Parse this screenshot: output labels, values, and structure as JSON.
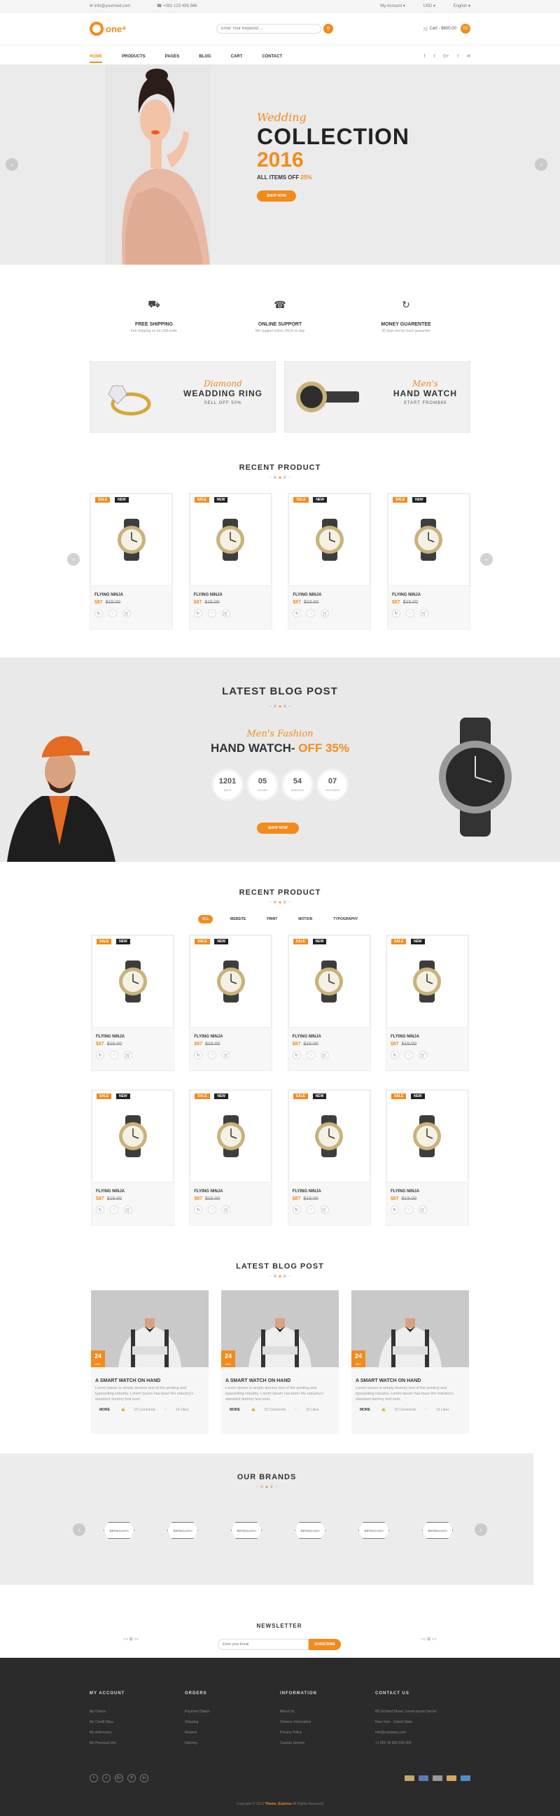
{
  "topbar": {
    "email": "info@yourmail.com",
    "phone": "+002 123 456 566",
    "account": "My Account",
    "currency": "USD",
    "language": "English"
  },
  "header": {
    "logo": "one",
    "logo_sup": "+",
    "search_placeholder": "Enter Your Keyword ...",
    "cart_label": "Cart - $600.00",
    "cart_count": "02"
  },
  "nav": {
    "items": [
      "HOME",
      "PRODUCTS",
      "PAGES",
      "BLOG",
      "CART",
      "CONTACT"
    ],
    "social": [
      "f",
      "t",
      "G+",
      "f",
      "✉"
    ]
  },
  "hero": {
    "script": "Wedding",
    "title": "COLLECTION",
    "year": "2016",
    "offer_prefix": "ALL ITEMS OFF ",
    "offer_value": "25%",
    "button": "SHOP NOW"
  },
  "features": [
    {
      "icon": "truck-icon",
      "glyph": "⛟",
      "title": "FREE SHIPPING",
      "sub": "free shipping on all USA order"
    },
    {
      "icon": "headset-icon",
      "glyph": "☎",
      "title": "ONLINE SUPPORT",
      "sub": "We support online 24/24 on day"
    },
    {
      "icon": "refresh-icon",
      "glyph": "↻",
      "title": "MONEY GUARENTEE",
      "sub": "30 days money back guarantee"
    }
  ],
  "promos": [
    {
      "script": "Diamond",
      "title": "WEADDING RING",
      "sub": "SELL OFF 50%"
    },
    {
      "script": "Men's",
      "title": "HAND WATCH",
      "sub": "START FROM$69"
    }
  ],
  "recent_product_title": "RECENT PRODUCT",
  "product": {
    "sale": "SALE",
    "new": "NEW",
    "name": "FLYING NINJA",
    "price": "$87",
    "old_price": "$15.00"
  },
  "blog_banner": {
    "title": "LATEST BLOG POST",
    "script": "Men's Fashion",
    "headline": "HAND WATCH- ",
    "headline_accent": "OFF 35%",
    "countdown": [
      {
        "value": "1201",
        "unit": "DAYS"
      },
      {
        "value": "05",
        "unit": "HOURS"
      },
      {
        "value": "54",
        "unit": "MINUTES"
      },
      {
        "value": "07",
        "unit": "SECONDS"
      }
    ],
    "button": "SHOP NOW"
  },
  "recent_product_title_2": "RECENT PRODUCT",
  "filters": [
    "ALL",
    "WEBSITE",
    "PRINT",
    "MOTION",
    "TYPOGRAPHY"
  ],
  "latest_blog_title": "LATEST BLOG POST",
  "blog_post": {
    "day": "24",
    "month": "DEC",
    "title": "A SMART WATCH ON HAND",
    "desc": "Lorem Ipsum is simply dummy text of the printing and typesetting industry. Lorem Ipsum has been the industry's standard dummy text ever.",
    "more": "MORE",
    "comments": "15 Comments",
    "likes": "15 Likes"
  },
  "brands_title": "OUR BRANDS",
  "brand_logo": "RETROLOGO",
  "newsletter": {
    "title": "NEWSLETTER",
    "placeholder": "Enter your Email",
    "button": "SUBSCRIBE"
  },
  "footer": {
    "cols": [
      {
        "title": "MY ACCOUNT",
        "items": [
          "My Orders",
          "My Credit Slips",
          "My Addresses",
          "My Personal Info"
        ]
      },
      {
        "title": "ORDERS",
        "items": [
          "Payment Option",
          "Shipping",
          "Returns",
          "Delivery"
        ]
      },
      {
        "title": "INFORMATION",
        "items": [
          "About Us",
          "Delivery Information",
          "Privacy Policy",
          "Custom Service"
        ]
      },
      {
        "title": "CONTACT US",
        "items": [
          "88 Orchard Street, Lorem Ipsum Saroni",
          "New York - United State",
          "info@company.com",
          "+1 002 45 800 595 004"
        ]
      }
    ],
    "social": [
      "f",
      "t",
      "G+",
      "P",
      "in"
    ],
    "copyright_prefix": "Copyright © 2016 ",
    "copyright_brand": "Theme_Express",
    "copyright_suffix": " All Rights Reserved"
  },
  "colors": {
    "accent": "#f38b1c",
    "dark": "#2b2b2b",
    "light_bg": "#ebebeb"
  }
}
